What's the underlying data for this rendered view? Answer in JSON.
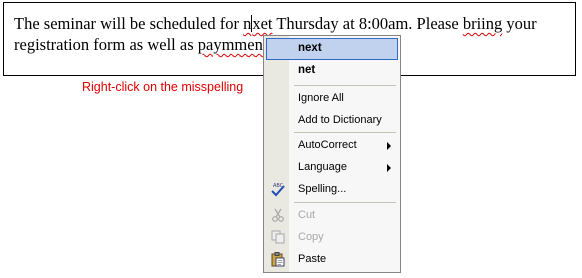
{
  "document": {
    "line1_before": "The seminar will be scheduled for ",
    "line1_misspelled_1": "nxet",
    "line1_mid": " Thursday at 8:00am.  Please ",
    "line1_misspelled_2": "briing",
    "line1_after": " your",
    "line2_before": "registration form as well as ",
    "line2_misspelled": "paymment",
    "line2_after": "."
  },
  "hint": "Right-click on the misspelling",
  "context_menu": {
    "suggestions": [
      "next",
      "net"
    ],
    "items": {
      "ignore_all": "Ignore All",
      "add_to_dictionary": "Add to Dictionary",
      "autocorrect": "AutoCorrect",
      "language": "Language",
      "spelling": "Spelling...",
      "cut": "Cut",
      "copy": "Copy",
      "paste": "Paste"
    }
  },
  "colors": {
    "hint_text": "#e00000",
    "spelling_underline": "#d40000",
    "menu_highlight": "#c1d2ee",
    "menu_highlight_border": "#316ac5"
  }
}
